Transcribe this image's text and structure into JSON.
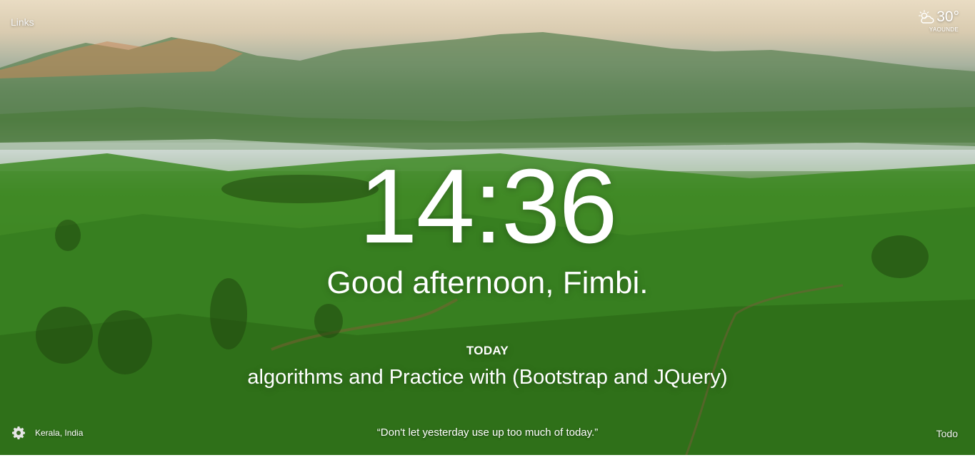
{
  "top_left": {
    "links_label": "Links"
  },
  "weather": {
    "icon": "partly-cloudy-icon",
    "temperature": "30°",
    "location": "YAOUNDE"
  },
  "clock": {
    "time": "14:36"
  },
  "greeting": {
    "text": "Good afternoon, Fimbi."
  },
  "focus": {
    "label": "TODAY",
    "text": "algorithms and Practice with (Bootstrap and JQuery)"
  },
  "bottom_bar": {
    "settings_icon": "gear-icon",
    "photo_location": "Kerala, India",
    "quote": "“Don't let yesterday use up too much of today.”",
    "todo_label": "Todo"
  },
  "colors": {
    "text": "#ffffff",
    "sky": "#e9dcc3",
    "hills": "#3f7d22"
  }
}
